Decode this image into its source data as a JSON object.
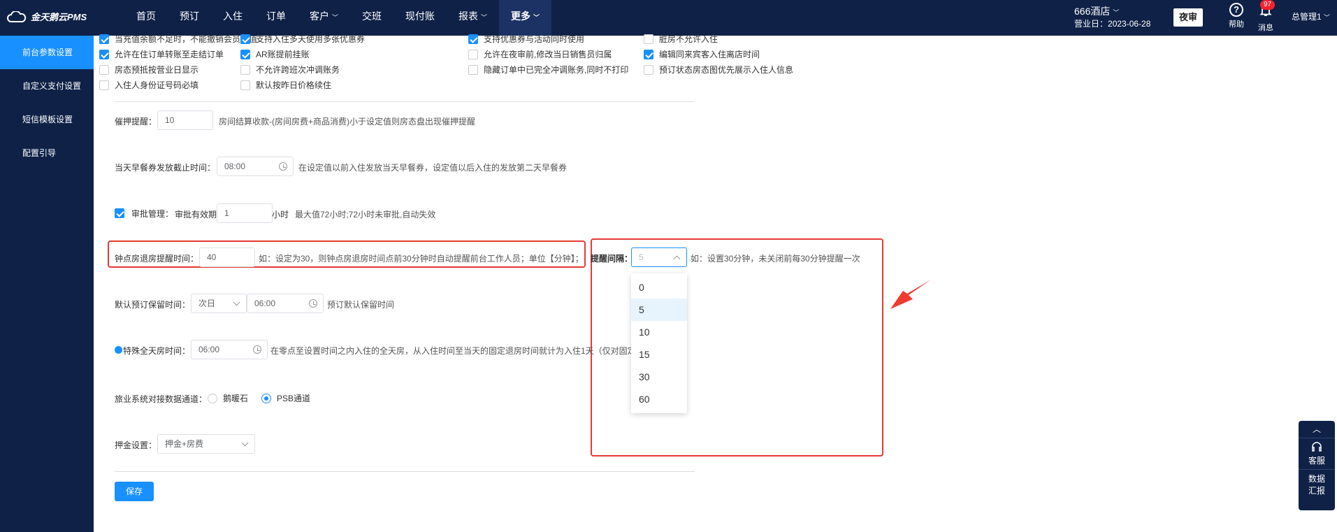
{
  "app": {
    "logo_text": "金天鹅云PMS"
  },
  "nav": [
    {
      "label": "首页",
      "caret": false,
      "active": false
    },
    {
      "label": "预订",
      "caret": false,
      "active": false
    },
    {
      "label": "入住",
      "caret": false,
      "active": false
    },
    {
      "label": "订单",
      "caret": false,
      "active": false
    },
    {
      "label": "客户",
      "caret": true,
      "active": false
    },
    {
      "label": "交班",
      "caret": false,
      "active": false
    },
    {
      "label": "现付账",
      "caret": false,
      "active": false
    },
    {
      "label": "报表",
      "caret": true,
      "active": false
    },
    {
      "label": "更多",
      "caret": true,
      "active": true
    }
  ],
  "header": {
    "hotel": "666酒店",
    "business_date_label": "营业日：",
    "business_date": "2023-06-28",
    "night_audit": "夜审",
    "help": "帮助",
    "messages": "消息",
    "message_count": "97",
    "user": "总管理1"
  },
  "sidebar": [
    {
      "label": "前台参数设置",
      "active": true
    },
    {
      "label": "自定义支付设置",
      "active": false
    },
    {
      "label": "短信模板设置",
      "active": false
    },
    {
      "label": "配置引导",
      "active": false
    }
  ],
  "checkboxes": {
    "col1": [
      {
        "label": "当充值余额不足时，不能撤销会员充值",
        "checked": true
      },
      {
        "label": "允许在住订单转账至走结订单",
        "checked": true
      },
      {
        "label": "房态预抵按营业日显示",
        "checked": false
      },
      {
        "label": "入住人身份证号码必填",
        "checked": false
      }
    ],
    "col2": [
      {
        "label": "支持入住多天使用多张优惠券",
        "checked": true
      },
      {
        "label": "AR账提前挂账",
        "checked": true
      },
      {
        "label": "不允许跨班次冲调账务",
        "checked": false
      },
      {
        "label": "默认按昨日价格续住",
        "checked": false
      }
    ],
    "col3": [
      {
        "label": "支持优惠券与活动同时使用",
        "checked": true
      },
      {
        "label": "允许在夜审前,修改当日销售员归属",
        "checked": false
      },
      {
        "label": "隐藏订单中已完全冲调账务,同时不打印",
        "checked": false
      }
    ],
    "col4": [
      {
        "label": "脏房不允许入住",
        "checked": false
      },
      {
        "label": "编辑同来宾客入住离店时间",
        "checked": true
      },
      {
        "label": "预订状态房态图优先展示入住人信息",
        "checked": false
      }
    ]
  },
  "deposit_reminder": {
    "label": "催押提醒：",
    "value": "10",
    "hint": "房间结算收款-(房间房费+商品消费)小于设定值则房态盘出现催押提醒"
  },
  "breakfast": {
    "label": "当天早餐券发放截止时间：",
    "value": "08:00",
    "hint": "在设定值以前入住发放当天早餐券，设定值以后入住的发放第二天早餐券"
  },
  "approval": {
    "checked": true,
    "label": "审批管理：",
    "validity_label": "审批有效期",
    "value": "1",
    "unit": "小时",
    "hint": "最大值72小时;72小时未审批,自动失效"
  },
  "hourly_checkout": {
    "label": "钟点房退房提醒时间：",
    "value": "40",
    "hint": "如：设定为30，则钟点房退房时间点前30分钟时自动提醒前台工作人员；单位【分钟】；",
    "interval_label": "提醒间隔：",
    "interval_placeholder": "5",
    "interval_hint": "如：设置30分钟，未关闭前每30分钟提醒一次",
    "interval_options": [
      "0",
      "5",
      "10",
      "15",
      "30",
      "60"
    ],
    "interval_selected": "5"
  },
  "reservation_hold": {
    "label": "默认预订保留时间：",
    "day": "次日",
    "time": "06:00",
    "hint": "预订默认保留时间"
  },
  "fullday_room": {
    "label": "特殊全天房时间：",
    "time": "06:00",
    "hint": "在零点至设置时间之内入住的全天房，从入住时间至当天的固定退房时间就计为入住1天（仅对固定"
  },
  "tourism": {
    "label": "旅业系统对接数据通道：",
    "options": [
      {
        "label": "鹅暖石",
        "selected": false
      },
      {
        "label": "PSB通道",
        "selected": true
      }
    ]
  },
  "deposit_setting": {
    "label": "押金设置：",
    "value": "押金+房费"
  },
  "save_label": "保存",
  "float_panel": {
    "service": "客服",
    "report_line1": "数据",
    "report_line2": "汇报"
  }
}
